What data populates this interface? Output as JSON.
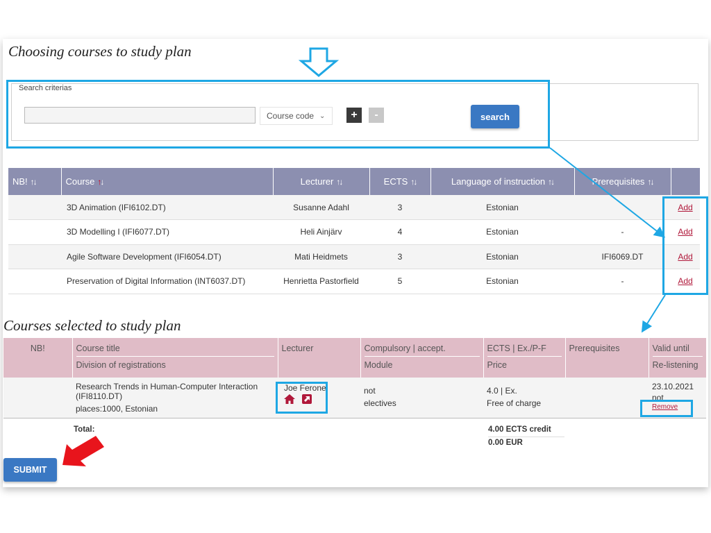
{
  "headings": {
    "choosing": "Choosing courses to study plan",
    "selected": "Courses selected to study plan"
  },
  "search": {
    "legend": "Search criterias",
    "input_value": "",
    "select_value": "Course code",
    "plus_label": "+",
    "minus_label": "-",
    "button_label": "search"
  },
  "courses_table": {
    "headers": [
      "NB!",
      "Course",
      "Lecturer",
      "ECTS",
      "Language of instruction",
      "Prerequisites",
      ""
    ],
    "sort_glyph": "↑↓",
    "rows": [
      {
        "nb": "",
        "course": "3D Animation (IFI6102.DT)",
        "lecturer": "Susanne Adahl",
        "ects": "3",
        "language": "Estonian",
        "prerequisites": "",
        "action": "Add"
      },
      {
        "nb": "",
        "course": "3D Modelling I (IFI6077.DT)",
        "lecturer": "Heli Ainjärv",
        "ects": "4",
        "language": "Estonian",
        "prerequisites": "-",
        "action": "Add"
      },
      {
        "nb": "",
        "course": "Agile Software Development (IFI6054.DT)",
        "lecturer": "Mati Heidmets",
        "ects": "3",
        "language": "Estonian",
        "prerequisites": "IFI6069.DT",
        "action": "Add"
      },
      {
        "nb": "",
        "course": "Preservation of Digital Information (INT6037.DT)",
        "lecturer": "Henrietta Pastorfield",
        "ects": "5",
        "language": "Estonian",
        "prerequisites": "-",
        "action": "Add"
      }
    ]
  },
  "selected_table": {
    "headers": {
      "nb": "NB!",
      "course_title": "Course title",
      "division": "Division of registrations",
      "lecturer": "Lecturer",
      "compulsory": "Compulsory | accept.",
      "module": "Module",
      "ects": "ECTS | Ex./P-F",
      "price": "Price",
      "prerequisites": "Prerequisites",
      "valid_until": "Valid until",
      "relistening": "Re-listening"
    },
    "row": {
      "nb": "",
      "course_title": "Research Trends in Human-Computer Interaction (IFI8110.DT)",
      "division": "places:1000, Estonian",
      "lecturer": "Joe Ferone",
      "lecturer_icons": [
        "home-icon",
        "external-link-icon"
      ],
      "compulsory": "not",
      "module": "electives",
      "ects": "4.0 | Ex.",
      "price": "Free of charge",
      "prerequisites": "",
      "valid_until": "23.10.2021",
      "relistening": "not",
      "remove_label": "Remove"
    }
  },
  "totals": {
    "label": "Total:",
    "ects_credit": "4.00 ECTS credit",
    "eur": "0.00 EUR"
  },
  "submit_label": "SUBMIT",
  "colors": {
    "table_header": "#8c8fb0",
    "selected_header": "#e0bcc7",
    "button_blue": "#3a78c3",
    "highlight": "#1ea7e4",
    "link_red": "#b0183a",
    "arrow_red": "#e8141c"
  }
}
